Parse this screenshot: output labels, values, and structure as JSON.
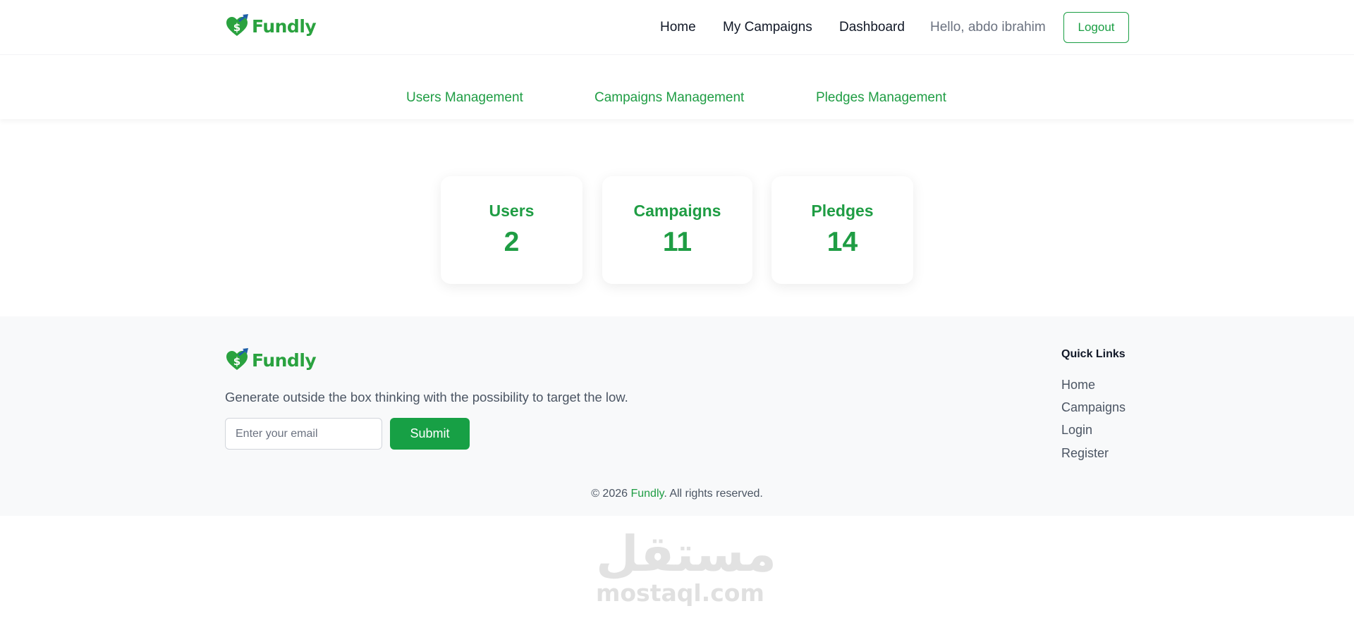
{
  "brand": {
    "name": "Fundly",
    "accent": "#1f9d44"
  },
  "header": {
    "nav": [
      "Home",
      "My Campaigns",
      "Dashboard"
    ],
    "greeting": "Hello, abdo ibrahim",
    "logout_label": "Logout"
  },
  "management_tabs": [
    "Users Management",
    "Campaigns Management",
    "Pledges Management"
  ],
  "stats": [
    {
      "label": "Users",
      "value": "2"
    },
    {
      "label": "Campaigns",
      "value": "11"
    },
    {
      "label": "Pledges",
      "value": "14"
    }
  ],
  "footer": {
    "tagline": "Generate outside the box thinking with the possibility to target the low.",
    "email_placeholder": "Enter your email",
    "submit_label": "Submit",
    "quick_links_title": "Quick Links",
    "quick_links": [
      "Home",
      "Campaigns",
      "Login",
      "Register"
    ],
    "copyright_prefix": "© 2026 ",
    "copyright_brand": "Fundly",
    "copyright_suffix": ". All rights reserved."
  },
  "watermark": {
    "arabic": "مستقل",
    "latin": "mostaql.com"
  },
  "icons": {
    "logo": "heart-dollar-arrow-icon"
  }
}
